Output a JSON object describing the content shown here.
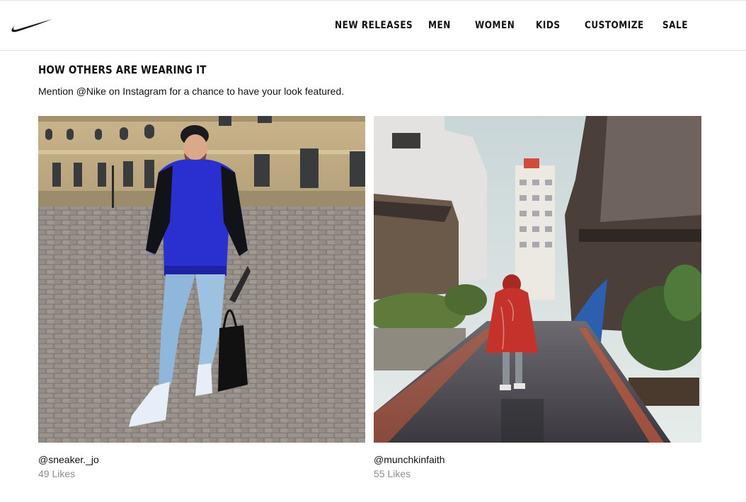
{
  "header": {
    "logo": "nike-swoosh-icon",
    "nav": [
      {
        "label": "NEW RELEASES"
      },
      {
        "label": "MEN"
      },
      {
        "label": "WOMEN"
      },
      {
        "label": "KIDS"
      },
      {
        "label": "CUSTOMIZE"
      },
      {
        "label": "SALE"
      }
    ]
  },
  "section": {
    "title": "HOW OTHERS ARE WEARING IT",
    "subtitle": "Mention @Nike on Instagram for a chance to have your look featured."
  },
  "posts": [
    {
      "handle": "@sneaker._jo",
      "likes": "49 Likes"
    },
    {
      "handle": "@munchkinfaith",
      "likes": "55 Likes"
    }
  ],
  "colors": {
    "text": "#111111",
    "muted": "#8d8d8d",
    "jacket": "#2a2fd0",
    "cloak": "#c4322b"
  }
}
